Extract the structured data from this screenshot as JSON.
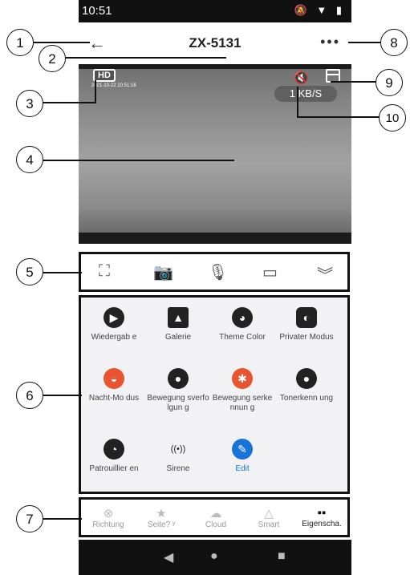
{
  "statusbar": {
    "time": "10:51",
    "icons": "🔕 ▼ ▮"
  },
  "header": {
    "title": "ZX-5131",
    "back_icon": "←",
    "more_icon": "•••"
  },
  "video": {
    "hd_badge": "HD",
    "timestamp": "2021-10-22 10:51:16",
    "mute_icon": "🔇",
    "speed": "1 KB/S"
  },
  "toolbar": {
    "items": [
      "screenshot-icon",
      "camera-icon",
      "microphone-icon",
      "video-record-icon",
      "collapse-icon"
    ]
  },
  "features": [
    {
      "label": "Wiedergab e",
      "icon": "▶",
      "color": "#222222"
    },
    {
      "label": "Galerie",
      "icon": "▲",
      "color": "#222222"
    },
    {
      "label": "Theme Color",
      "icon": "◕",
      "color": "#222222"
    },
    {
      "label": "Privater Modus",
      "icon": "◐",
      "color": "#222222"
    },
    {
      "label": "Nacht-Mo dus",
      "icon": "◒",
      "color": "#e8542f"
    },
    {
      "label": "Bewegung sverfolgun g",
      "icon": "●",
      "color": "#222222"
    },
    {
      "label": "Bewegung serkennun g",
      "icon": "✱",
      "color": "#e8542f"
    },
    {
      "label": "Tonerkenn ung",
      "icon": "●",
      "color": "#222222"
    },
    {
      "label": "Patrouillier en",
      "icon": "◔",
      "color": "#222222"
    },
    {
      "label": "Sirene",
      "icon": "((•))",
      "color": "#ffffff"
    },
    {
      "label": "Edit",
      "icon": "✎",
      "color": "#1a73d9"
    }
  ],
  "tabs": [
    {
      "label": "Richtung",
      "icon": "⊗"
    },
    {
      "label": "Seite? ʸ",
      "icon": "★"
    },
    {
      "label": "Cloud",
      "icon": "☁"
    },
    {
      "label": "Smart",
      "icon": "△"
    },
    {
      "label": "Eigenscha.",
      "icon": "▪▪"
    }
  ],
  "navbar": {
    "back": "◀",
    "home": "●",
    "recent": "■"
  },
  "callouts": [
    "1",
    "2",
    "3",
    "4",
    "5",
    "6",
    "7",
    "8",
    "9",
    "10"
  ]
}
